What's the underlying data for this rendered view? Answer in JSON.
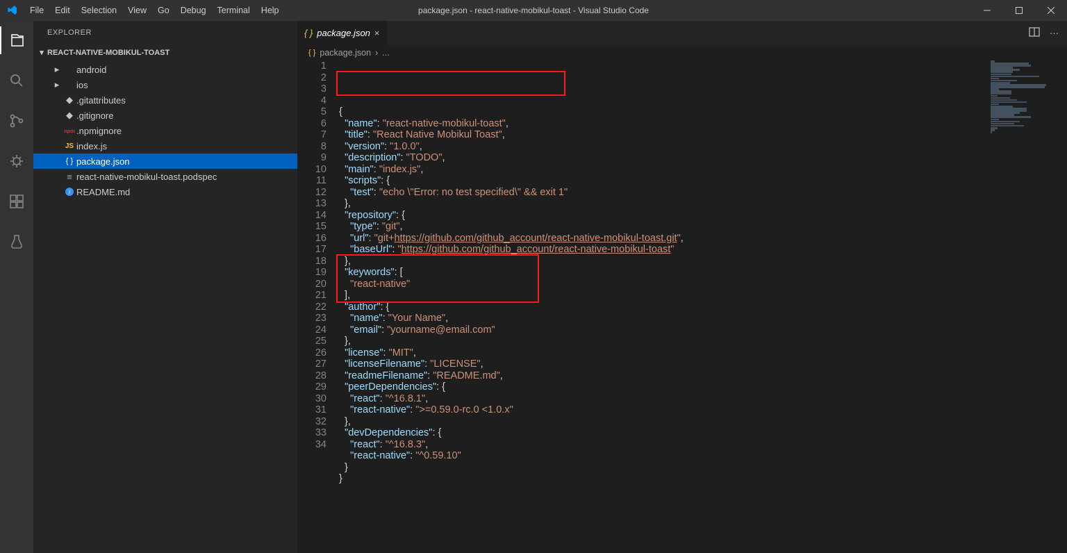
{
  "titlebar": {
    "title": "package.json - react-native-mobikul-toast - Visual Studio Code",
    "menu": [
      "File",
      "Edit",
      "Selection",
      "View",
      "Go",
      "Debug",
      "Terminal",
      "Help"
    ]
  },
  "sidebar": {
    "title": "EXPLORER",
    "section": "REACT-NATIVE-MOBIKUL-TOAST",
    "items": [
      {
        "kind": "folder",
        "label": "android",
        "depth": 1
      },
      {
        "kind": "folder",
        "label": "ios",
        "depth": 1
      },
      {
        "kind": "git",
        "label": ".gitattributes",
        "depth": 1
      },
      {
        "kind": "git",
        "label": ".gitignore",
        "depth": 1
      },
      {
        "kind": "npm",
        "label": ".npmignore",
        "depth": 1
      },
      {
        "kind": "js",
        "label": "index.js",
        "depth": 1
      },
      {
        "kind": "json",
        "label": "package.json",
        "depth": 1,
        "selected": true
      },
      {
        "kind": "spec",
        "label": "react-native-mobikul-toast.podspec",
        "depth": 1
      },
      {
        "kind": "info",
        "label": "README.md",
        "depth": 1
      }
    ]
  },
  "tab": {
    "label": "package.json"
  },
  "breadcrumbs": {
    "file": "package.json",
    "rest": "..."
  },
  "code": {
    "lines": [
      [
        {
          "c": "p",
          "t": "{"
        }
      ],
      [
        {
          "c": "p",
          "t": "  "
        },
        {
          "c": "k",
          "t": "\"name\""
        },
        {
          "c": "p",
          "t": ": "
        },
        {
          "c": "s",
          "t": "\"react-native-mobikul-toast\""
        },
        {
          "c": "p",
          "t": ","
        }
      ],
      [
        {
          "c": "p",
          "t": "  "
        },
        {
          "c": "k",
          "t": "\"title\""
        },
        {
          "c": "p",
          "t": ": "
        },
        {
          "c": "s",
          "t": "\"React Native Mobikul Toast\""
        },
        {
          "c": "p",
          "t": ","
        }
      ],
      [
        {
          "c": "p",
          "t": "  "
        },
        {
          "c": "k",
          "t": "\"version\""
        },
        {
          "c": "p",
          "t": ": "
        },
        {
          "c": "s",
          "t": "\"1.0.0\""
        },
        {
          "c": "p",
          "t": ","
        }
      ],
      [
        {
          "c": "p",
          "t": "  "
        },
        {
          "c": "k",
          "t": "\"description\""
        },
        {
          "c": "p",
          "t": ": "
        },
        {
          "c": "s",
          "t": "\"TODO\""
        },
        {
          "c": "p",
          "t": ","
        }
      ],
      [
        {
          "c": "p",
          "t": "  "
        },
        {
          "c": "k",
          "t": "\"main\""
        },
        {
          "c": "p",
          "t": ": "
        },
        {
          "c": "s",
          "t": "\"index.js\""
        },
        {
          "c": "p",
          "t": ","
        }
      ],
      [
        {
          "c": "p",
          "t": "  "
        },
        {
          "c": "k",
          "t": "\"scripts\""
        },
        {
          "c": "p",
          "t": ": {"
        }
      ],
      [
        {
          "c": "p",
          "t": "    "
        },
        {
          "c": "k",
          "t": "\"test\""
        },
        {
          "c": "p",
          "t": ": "
        },
        {
          "c": "s",
          "t": "\"echo \\\"Error: no test specified\\\" && exit 1\""
        }
      ],
      [
        {
          "c": "p",
          "t": "  },"
        }
      ],
      [
        {
          "c": "p",
          "t": "  "
        },
        {
          "c": "k",
          "t": "\"repository\""
        },
        {
          "c": "p",
          "t": ": {"
        }
      ],
      [
        {
          "c": "p",
          "t": "    "
        },
        {
          "c": "k",
          "t": "\"type\""
        },
        {
          "c": "p",
          "t": ": "
        },
        {
          "c": "s",
          "t": "\"git\""
        },
        {
          "c": "p",
          "t": ","
        }
      ],
      [
        {
          "c": "p",
          "t": "    "
        },
        {
          "c": "k",
          "t": "\"url\""
        },
        {
          "c": "p",
          "t": ": "
        },
        {
          "c": "s",
          "t": "\"git+"
        },
        {
          "c": "u",
          "t": "https://github.com/github_account/react-native-mobikul-toast.git"
        },
        {
          "c": "s",
          "t": "\""
        },
        {
          "c": "p",
          "t": ","
        }
      ],
      [
        {
          "c": "p",
          "t": "    "
        },
        {
          "c": "k",
          "t": "\"baseUrl\""
        },
        {
          "c": "p",
          "t": ": "
        },
        {
          "c": "s",
          "t": "\""
        },
        {
          "c": "u",
          "t": "https://github.com/github_account/react-native-mobikul-toast"
        },
        {
          "c": "s",
          "t": "\""
        }
      ],
      [
        {
          "c": "p",
          "t": "  },"
        }
      ],
      [
        {
          "c": "p",
          "t": "  "
        },
        {
          "c": "k",
          "t": "\"keywords\""
        },
        {
          "c": "p",
          "t": ": ["
        }
      ],
      [
        {
          "c": "p",
          "t": "    "
        },
        {
          "c": "s",
          "t": "\"react-native\""
        }
      ],
      [
        {
          "c": "p",
          "t": "  ],"
        }
      ],
      [
        {
          "c": "p",
          "t": "  "
        },
        {
          "c": "k",
          "t": "\"author\""
        },
        {
          "c": "p",
          "t": ": {"
        }
      ],
      [
        {
          "c": "p",
          "t": "    "
        },
        {
          "c": "k",
          "t": "\"name\""
        },
        {
          "c": "p",
          "t": ": "
        },
        {
          "c": "s",
          "t": "\"Your Name\""
        },
        {
          "c": "p",
          "t": ","
        }
      ],
      [
        {
          "c": "p",
          "t": "    "
        },
        {
          "c": "k",
          "t": "\"email\""
        },
        {
          "c": "p",
          "t": ": "
        },
        {
          "c": "s",
          "t": "\"yourname@email.com\""
        }
      ],
      [
        {
          "c": "p",
          "t": "  },"
        }
      ],
      [
        {
          "c": "p",
          "t": "  "
        },
        {
          "c": "k",
          "t": "\"license\""
        },
        {
          "c": "p",
          "t": ": "
        },
        {
          "c": "s",
          "t": "\"MIT\""
        },
        {
          "c": "p",
          "t": ","
        }
      ],
      [
        {
          "c": "p",
          "t": "  "
        },
        {
          "c": "k",
          "t": "\"licenseFilename\""
        },
        {
          "c": "p",
          "t": ": "
        },
        {
          "c": "s",
          "t": "\"LICENSE\""
        },
        {
          "c": "p",
          "t": ","
        }
      ],
      [
        {
          "c": "p",
          "t": "  "
        },
        {
          "c": "k",
          "t": "\"readmeFilename\""
        },
        {
          "c": "p",
          "t": ": "
        },
        {
          "c": "s",
          "t": "\"README.md\""
        },
        {
          "c": "p",
          "t": ","
        }
      ],
      [
        {
          "c": "p",
          "t": "  "
        },
        {
          "c": "k",
          "t": "\"peerDependencies\""
        },
        {
          "c": "p",
          "t": ": {"
        }
      ],
      [
        {
          "c": "p",
          "t": "    "
        },
        {
          "c": "k",
          "t": "\"react\""
        },
        {
          "c": "p",
          "t": ": "
        },
        {
          "c": "s",
          "t": "\"^16.8.1\""
        },
        {
          "c": "p",
          "t": ","
        }
      ],
      [
        {
          "c": "p",
          "t": "    "
        },
        {
          "c": "k",
          "t": "\"react-native\""
        },
        {
          "c": "p",
          "t": ": "
        },
        {
          "c": "s",
          "t": "\">=0.59.0-rc.0 <1.0.x\""
        }
      ],
      [
        {
          "c": "p",
          "t": "  },"
        }
      ],
      [
        {
          "c": "p",
          "t": "  "
        },
        {
          "c": "k",
          "t": "\"devDependencies\""
        },
        {
          "c": "p",
          "t": ": {"
        }
      ],
      [
        {
          "c": "p",
          "t": "    "
        },
        {
          "c": "k",
          "t": "\"react\""
        },
        {
          "c": "p",
          "t": ": "
        },
        {
          "c": "s",
          "t": "\"^16.8.3\""
        },
        {
          "c": "p",
          "t": ","
        }
      ],
      [
        {
          "c": "p",
          "t": "    "
        },
        {
          "c": "k",
          "t": "\"react-native\""
        },
        {
          "c": "p",
          "t": ": "
        },
        {
          "c": "s",
          "t": "\"^0.59.10\""
        }
      ],
      [
        {
          "c": "p",
          "t": "  }"
        }
      ],
      [
        {
          "c": "p",
          "t": "}"
        }
      ],
      [
        {
          "c": "p",
          "t": ""
        }
      ]
    ]
  }
}
